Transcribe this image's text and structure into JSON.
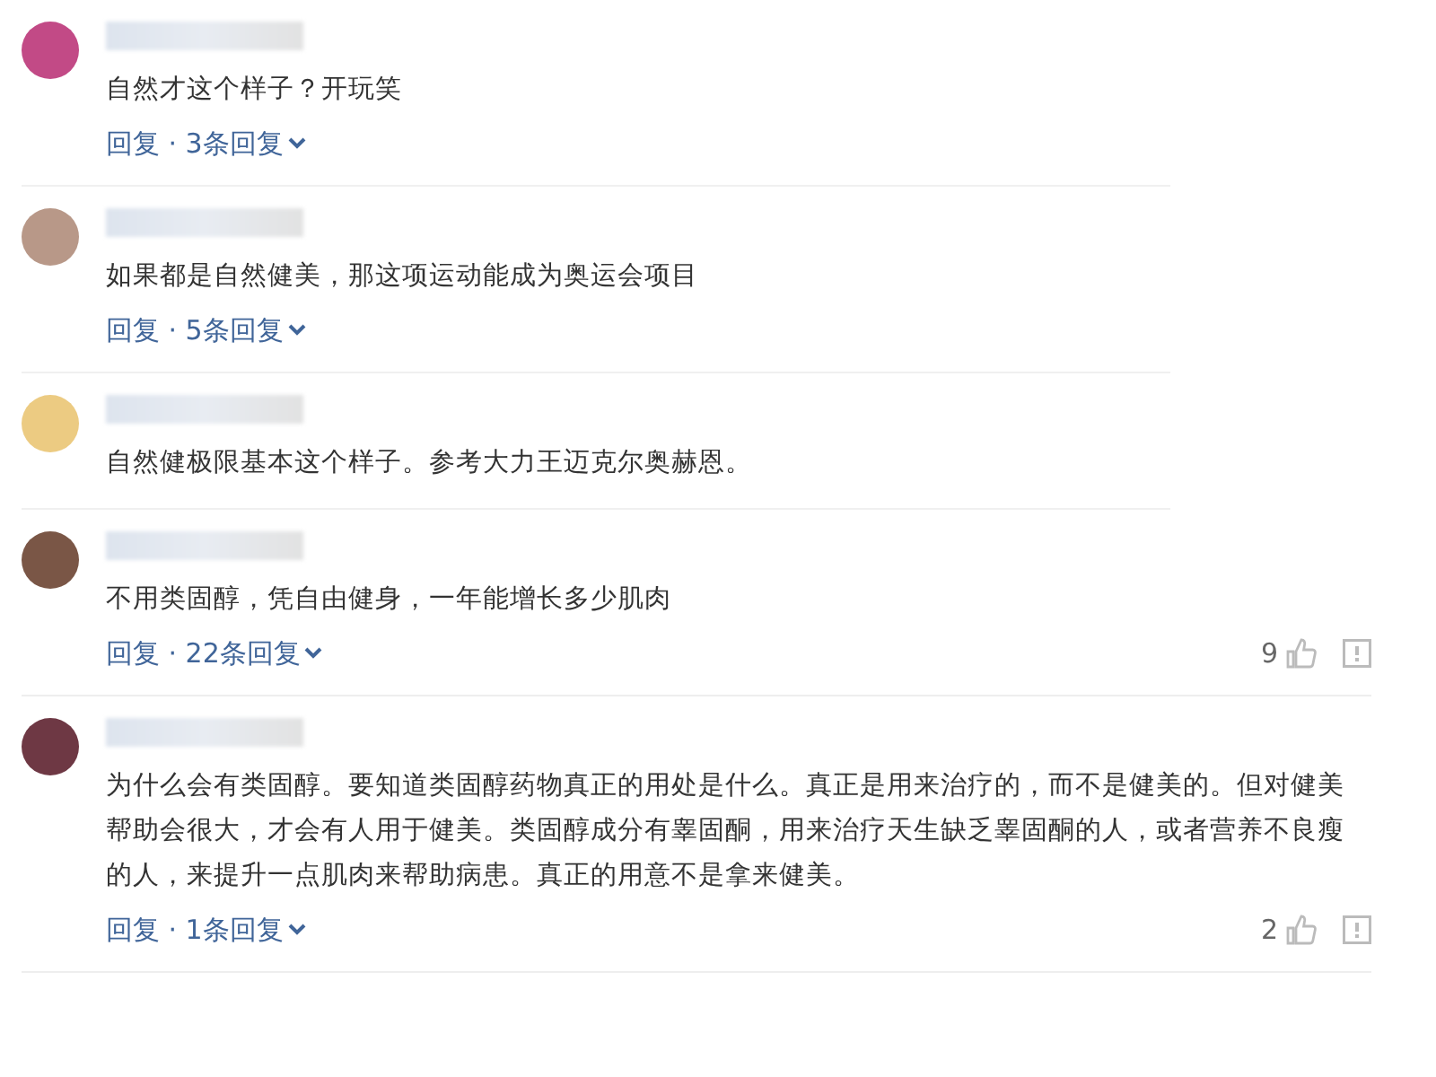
{
  "comments": [
    {
      "color": "#c24a86",
      "text": "自然才这个样子？开玩笑",
      "replies": "回复 · 3条回复"
    },
    {
      "color": "#b89888",
      "text": "如果都是自然健美，那这项运动能成为奥运会项目",
      "replies": "回复 · 5条回复"
    },
    {
      "color": "#eccb82",
      "text": "自然健极限基本这个样子。参考大力王迈克尔奥赫恩。"
    },
    {
      "color": "#7a5646",
      "text": "不用类固醇，凭自由健身，一年能增长多少肌肉",
      "replies": "回复 · 22条回复",
      "likes": "9"
    },
    {
      "color": "#6e3844",
      "text": "为什么会有类固醇。要知道类固醇药物真正的用处是什么。真正是用来治疗的，而不是健美的。但对健美帮助会很大，才会有人用于健美。类固醇成分有睾固酮，用来治疗天生缺乏睾固酮的人，或者营养不良瘦的人，来提升一点肌肉来帮助病患。真正的用意不是拿来健美。",
      "replies": "回复 · 1条回复",
      "likes": "2"
    }
  ]
}
